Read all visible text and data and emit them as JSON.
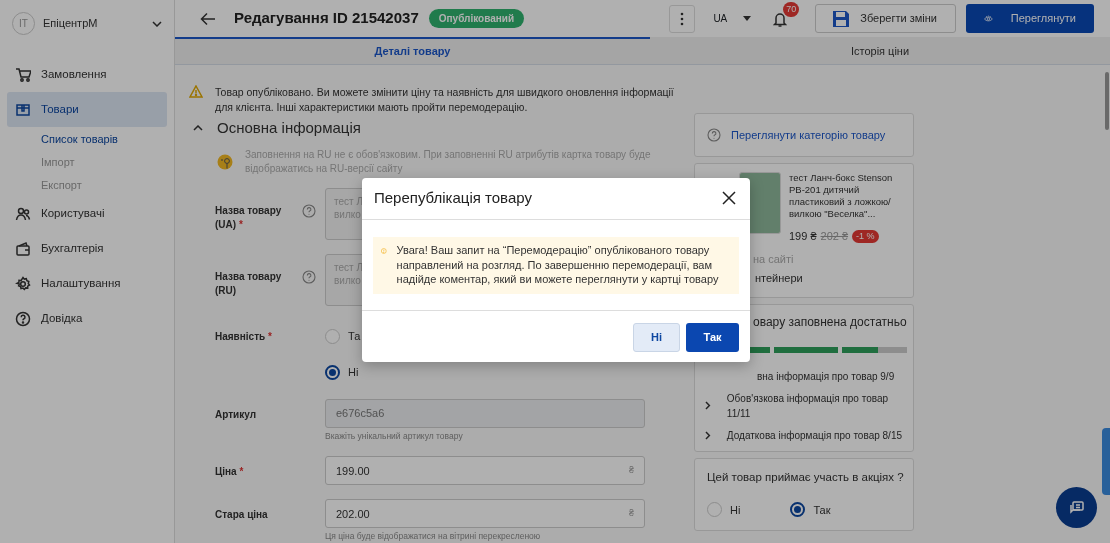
{
  "account": {
    "avatar": "IT",
    "name": "ЕпіцентрМ"
  },
  "sidebar": {
    "items": [
      {
        "label": "Замовлення",
        "selected": false
      },
      {
        "label": "Товари",
        "selected": true,
        "children": [
          {
            "label": "Список товарів",
            "selected": true
          },
          {
            "label": "Імпорт",
            "selected": false
          },
          {
            "label": "Експорт",
            "selected": false
          }
        ]
      },
      {
        "label": "Користувачі",
        "selected": false
      },
      {
        "label": "Бухгалтерія",
        "selected": false
      },
      {
        "label": "Налаштування",
        "selected": false
      },
      {
        "label": "Довідка",
        "selected": false
      }
    ]
  },
  "header": {
    "title": "Редагування ID 21542037",
    "status": "Опублікований",
    "language": "UA",
    "notifications": "70",
    "save_button": "Зберегти зміни",
    "preview_button": "Переглянути"
  },
  "tabs": [
    {
      "label": "Деталі товару",
      "selected": true
    },
    {
      "label": "Історія ціни",
      "selected": false
    }
  ],
  "form": {
    "notice": "Товар опубліковано. Ви можете змінити ціну та наявність для швидкого оновлення інформації для клієнта. Інші характеристики мають пройти перемодерацію.",
    "section_title": "Основна інформація",
    "expanded": true,
    "ru_note": "Заповнення на RU не є обов'язковим. При заповненні RU атрибутів картка товару буде відображатись на RU-версії сайту",
    "rows": [
      {
        "kind": "textarea",
        "label": "Назва товару (UA)",
        "required_mark": "*",
        "help": true,
        "lines": [
          "тест Л",
          "вилко"
        ]
      },
      {
        "kind": "textarea",
        "label": "Назва товару (RU)",
        "help": true,
        "lines": [
          "тест Л",
          "вилко"
        ]
      },
      {
        "kind": "radio",
        "label": "Наявність",
        "required_mark": "*",
        "options": [
          {
            "label": "Та",
            "selected": false
          },
          {
            "label": "Ні",
            "selected": true
          }
        ]
      },
      {
        "kind": "input",
        "label": "Артикул",
        "value": "e676c5a6",
        "disabled": true,
        "hint": "Вкажіть унікальний артикул товару"
      },
      {
        "kind": "input",
        "label": "Ціна",
        "required_mark": "*",
        "value": "199.00",
        "suffix": "₴",
        "disabled": false
      },
      {
        "kind": "input",
        "label": "Стара ціна",
        "value": "202.00",
        "suffix": "₴",
        "disabled": false,
        "hint": "Ця ціна буде відображатися на вітрині перекресленою"
      }
    ]
  },
  "side": {
    "category_link": "Переглянути категорію товару",
    "product": {
      "title": "тест Ланч-бокс Stenson PB-201 дитячий пластиковий з ложкою/вилкою \"Веселка\"...",
      "price": "199 ₴",
      "old_price": "202 ₴",
      "discount": "-1 %",
      "line_1": "на сайті",
      "line_2": "нтейнери"
    },
    "fill": {
      "title": "овару заповнена достатньо",
      "segments": [
        {
          "level": 1
        },
        {
          "level": 1
        },
        {
          "level": 0.55
        }
      ],
      "items": [
        {
          "label": "вна інформація про товар 9/9",
          "partial": true
        },
        {
          "label": "Обов'язкова інформація про товар 11/11",
          "partial": false
        },
        {
          "label": "Додаткова інформація про товар 8/15",
          "partial": false
        }
      ]
    },
    "promo": {
      "title": "Цей товар приймає участь в акціях ?",
      "options": [
        {
          "label": "Ні",
          "selected": false
        },
        {
          "label": "Так",
          "selected": true
        }
      ]
    }
  },
  "modal": {
    "title": "Перепублікація товару",
    "message": "Увага! Ваш запит на “Перемодерацію” опублікованого товару направлений на розгляд. По завершенню перемодерації, вам надійде коментар, який ви можете переглянути у картці товару",
    "buttons": [
      {
        "label": "Ні",
        "kind": "secondary"
      },
      {
        "label": "Так",
        "kind": "primary"
      }
    ]
  }
}
